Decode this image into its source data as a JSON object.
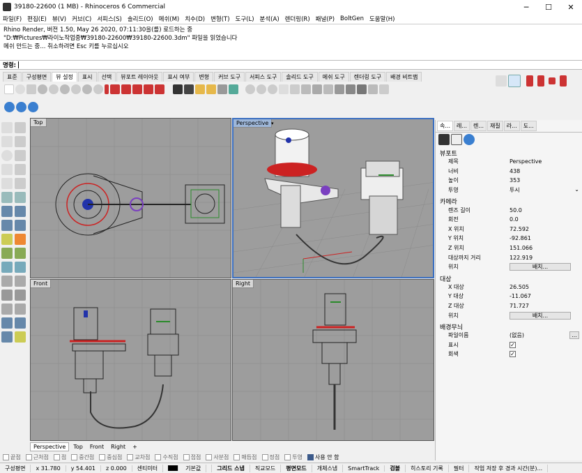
{
  "window": {
    "title": "39180-22600 (1 MB) - Rhinoceros 6 Commercial",
    "minimize": "─",
    "maximize": "☐",
    "close": "✕"
  },
  "menu": [
    "파일(F)",
    "편집(E)",
    "뷰(V)",
    "커브(C)",
    "서피스(S)",
    "솔리드(O)",
    "메쉬(M)",
    "치수(D)",
    "변형(T)",
    "도구(L)",
    "분석(A)",
    "렌더링(R)",
    "패널(P)",
    "BoltGen",
    "도움말(H)"
  ],
  "history": [
    "Rhino Render, 버전 1.50, May 26 2020, 07:11:30을(를) 로드하는 중",
    "\"D:₩Pictures₩라이노작업중₩39180-22600₩39180-22600.3dm\" 파일을 읽었습니다",
    "메쉬 만드는 중... 취소하려면 Esc 키를 누르십시오"
  ],
  "command": {
    "label": "명령:",
    "value": ""
  },
  "toolbar_tabs": [
    "표준",
    "구성평면",
    "뷰 설정",
    "표시",
    "선택",
    "뷰포트 레이아웃",
    "표시 여부",
    "변형",
    "커브 도구",
    "서피스 도구",
    "솔리드 도구",
    "메쉬 도구",
    "렌더링 도구",
    "배경 비트맵"
  ],
  "active_tab": "뷰 설정",
  "viewports": {
    "top": {
      "label": "Top"
    },
    "perspective": {
      "label": "Perspective"
    },
    "front": {
      "label": "Front"
    },
    "right": {
      "label": "Right"
    }
  },
  "viewport_tabs": [
    "Perspective",
    "Top",
    "Front",
    "Right",
    "+"
  ],
  "osnaps": [
    {
      "label": "끝점",
      "on": false
    },
    {
      "label": "근처점",
      "on": false
    },
    {
      "label": "점",
      "on": false
    },
    {
      "label": "중간점",
      "on": false
    },
    {
      "label": "중심점",
      "on": false
    },
    {
      "label": "교차점",
      "on": false
    },
    {
      "label": "수직점",
      "on": false
    },
    {
      "label": "접점",
      "on": false
    },
    {
      "label": "사분점",
      "on": false
    },
    {
      "label": "매듭점",
      "on": false
    },
    {
      "label": "정점",
      "on": false
    },
    {
      "label": "투영",
      "on": false
    },
    {
      "label": "사용 안 함",
      "on": true
    }
  ],
  "status": {
    "cplane": "구성평면",
    "x": "x 31.780",
    "y": "y 54.401",
    "z": "z 0.000",
    "units": "센티미터",
    "layer": "기본값",
    "items": [
      "그리드 스냅",
      "직교모드",
      "평면모드",
      "개체스냅",
      "SmartTrack",
      "검볼",
      "히스토리 기록",
      "필터",
      "작업 저장 후 경과 시간(분)..."
    ]
  },
  "panel": {
    "tabs": [
      "속...",
      "레...",
      "렌...",
      "재질",
      "라...",
      "도..."
    ],
    "viewport_section": "뷰포트",
    "viewport_rows": [
      [
        "제목",
        "Perspective"
      ],
      [
        "너비",
        "438"
      ],
      [
        "높이",
        "353"
      ],
      [
        "투영",
        "투시"
      ]
    ],
    "camera_section": "카메라",
    "camera_rows": [
      [
        "렌즈 길이",
        "50.0"
      ],
      [
        "회전",
        "0.0"
      ],
      [
        "X 위치",
        "72.592"
      ],
      [
        "Y 위치",
        "-92.861"
      ],
      [
        "Z 위치",
        "151.066"
      ],
      [
        "대상까지 거리",
        "122.919"
      ],
      [
        "위치",
        ""
      ]
    ],
    "target_section": "대상",
    "target_rows": [
      [
        "X 대상",
        "26.505"
      ],
      [
        "Y 대상",
        "-11.067"
      ],
      [
        "Z 대상",
        "71.727"
      ],
      [
        "위치",
        ""
      ]
    ],
    "wallpaper_section": "배경무늬",
    "wallpaper_rows": [
      [
        "파일이름",
        "(없음)"
      ],
      [
        "표시",
        ""
      ],
      [
        "회색",
        ""
      ]
    ],
    "place_button": "배치...",
    "browse_button": "...",
    "check": "✓"
  }
}
